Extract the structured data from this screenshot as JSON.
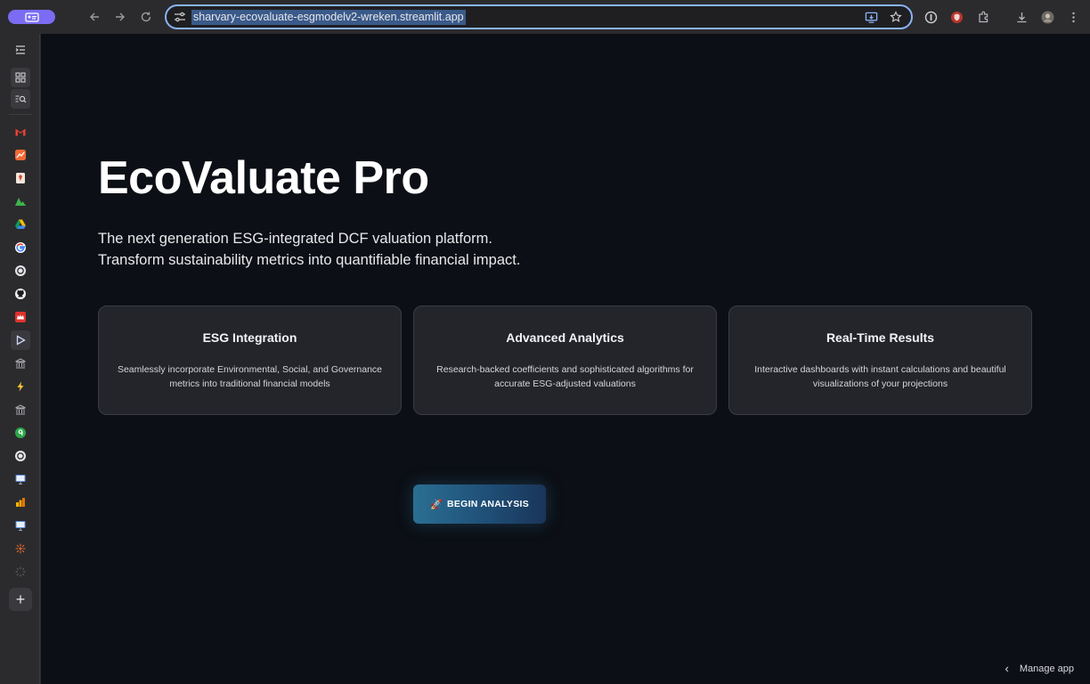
{
  "browser": {
    "url": "sharvary-ecovaluate-esgmodelv2-wreken.streamlit.app"
  },
  "app": {
    "title": "EcoValuate Pro",
    "subtitle_line1": "The next generation ESG-integrated DCF valuation platform.",
    "subtitle_line2": "Transform sustainability metrics into quantifiable financial impact.",
    "cards": [
      {
        "title": "ESG Integration",
        "description": "Seamlessly incorporate Environmental, Social, and Governance metrics into traditional financial models"
      },
      {
        "title": "Advanced Analytics",
        "description": "Research-backed coefficients and sophisticated algorithms for accurate ESG-adjusted valuations"
      },
      {
        "title": "Real-Time Results",
        "description": "Interactive dashboards with instant calculations and beautiful visualizations of your projections"
      }
    ],
    "cta_label": "BEGIN ANALYSIS",
    "manage_label": "Manage app"
  },
  "colors": {
    "accent_outline": "#8ab4f8",
    "profile": "#7b6cf3",
    "app_bg": "#0c0f15",
    "card_bg": "#23252b",
    "cta_start": "#2b6f93",
    "cta_end": "#1a3559"
  }
}
